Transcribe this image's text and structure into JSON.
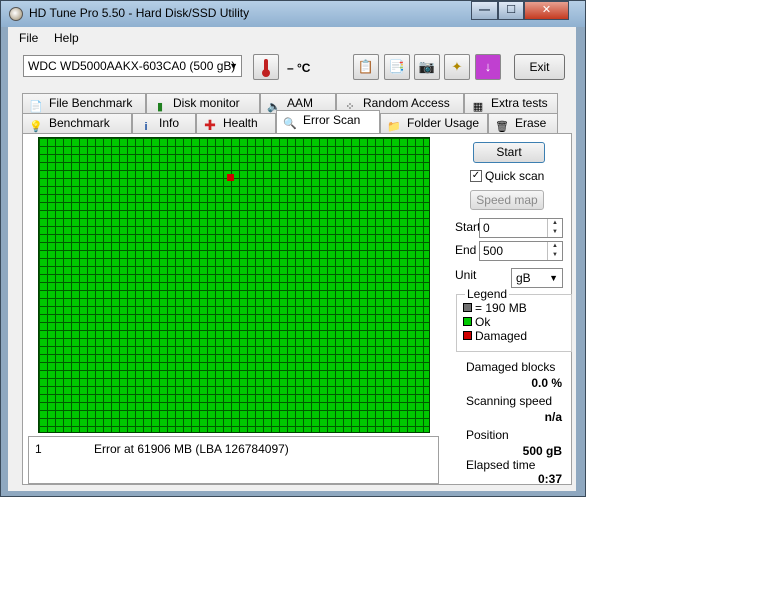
{
  "window": {
    "title": "HD Tune Pro 5.50 - Hard Disk/SSD Utility",
    "controls": {
      "minimize": "—",
      "maximize": "☐",
      "close": "✕"
    }
  },
  "menu": {
    "file": "File",
    "help": "Help"
  },
  "toolbar": {
    "drive": "WDC WD5000AAKX-603CA0 (500 gB)",
    "temperature": "– °C",
    "exit_label": "Exit",
    "icons": [
      "thermometer-icon",
      "copy-text-icon",
      "copy-all-icon",
      "camera-icon",
      "options-icon",
      "save-icon"
    ]
  },
  "tabs": {
    "row1": [
      "File Benchmark",
      "Disk monitor",
      "AAM",
      "Random Access",
      "Extra tests"
    ],
    "row2": [
      "Benchmark",
      "Info",
      "Health",
      "Error Scan",
      "Folder Usage",
      "Erase"
    ],
    "active": "Error Scan"
  },
  "scan_map": {
    "status_colors": {
      "ok": "#00c800",
      "damaged": "#d00000",
      "block": "#707070"
    },
    "damaged_count": 1
  },
  "log": [
    {
      "num": "1",
      "message": "Error at 61906 MB (LBA 126784097)"
    }
  ],
  "controls": {
    "start_label": "Start",
    "quick_scan_label": "Quick scan",
    "quick_scan_checked": true,
    "speed_map_label": "Speed map",
    "start_field_label": "Start",
    "start_value": "0",
    "end_field_label": "End",
    "end_value": "500",
    "unit_label": "Unit",
    "unit_value": "gB"
  },
  "legend": {
    "title": "Legend",
    "block": "= 190 MB",
    "ok": "Ok",
    "damaged": "Damaged"
  },
  "stats": {
    "damaged_blocks_label": "Damaged blocks",
    "damaged_blocks_value": "0.0 %",
    "scanning_speed_label": "Scanning speed",
    "scanning_speed_value": "n/a",
    "position_label": "Position",
    "position_value": "500 gB",
    "elapsed_label": "Elapsed time",
    "elapsed_value": "0:37"
  }
}
